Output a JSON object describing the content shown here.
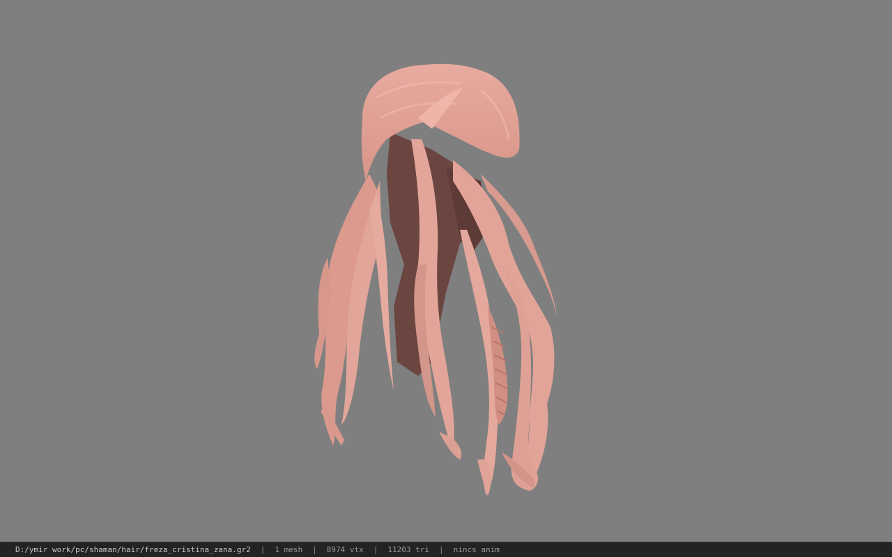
{
  "viewer": {
    "background_color": "#7f7f7f",
    "model_color": "#e0a297",
    "model_shadow_color": "#6b4540"
  },
  "status_bar": {
    "file_path": "D:/ymir work/pc/shaman/hair/freza_cristina_zana.gr2",
    "separator": "|",
    "mesh_count": "1 mesh",
    "vertex_count": "8974 vtx",
    "triangle_count": "11203 tri",
    "anim_status": "nincs anim"
  }
}
